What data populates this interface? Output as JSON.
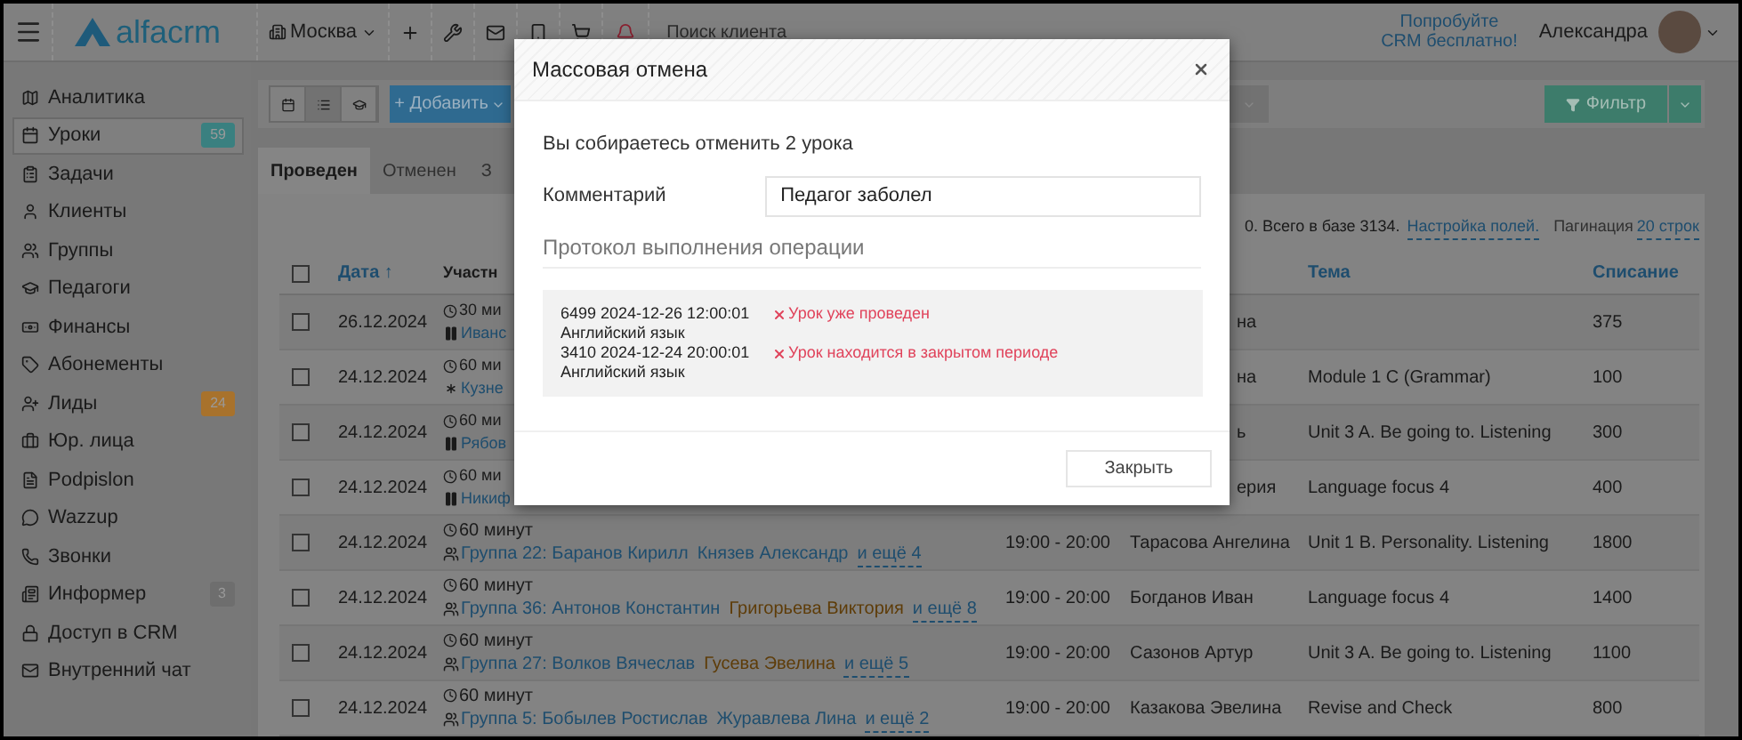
{
  "topbar": {
    "logo": "alfacrm",
    "city": "Москва",
    "search": {
      "placeholder": "Поиск клиента"
    },
    "promo": [
      "Попробуйте",
      "CRM бесплатно!"
    ],
    "user": "Александра"
  },
  "sidebar": {
    "items": [
      {
        "label": "Аналитика",
        "selected": false
      },
      {
        "label": "Уроки",
        "selected": true,
        "badge": "59",
        "color": "#3a8080"
      },
      {
        "label": "Задачи",
        "selected": false
      },
      {
        "label": "Клиенты",
        "selected": false
      },
      {
        "label": "Группы",
        "selected": false
      },
      {
        "label": "Педагоги",
        "selected": false
      },
      {
        "label": "Финансы",
        "selected": false
      },
      {
        "label": "Абонементы",
        "selected": false
      },
      {
        "label": "Лиды",
        "selected": false,
        "badge": "24",
        "color": "#a8722c"
      },
      {
        "label": "Юр. лица",
        "selected": false
      },
      {
        "label": "Podpislon",
        "selected": false
      },
      {
        "label": "Wazzup",
        "selected": false
      },
      {
        "label": "Звонки",
        "selected": false
      },
      {
        "label": "Информер",
        "selected": false,
        "badge": "3",
        "color": "#6e6e6e"
      },
      {
        "label": "Доступ в CRM",
        "selected": false
      },
      {
        "label": "Внутренний чат",
        "selected": false
      }
    ]
  },
  "toolbar": {
    "views": [
      {
        "selected": false
      },
      {
        "selected": true
      },
      {
        "selected": false
      }
    ],
    "add_button": "+ Добавить",
    "filter_button": "Фильтр"
  },
  "tabs": [
    {
      "label": "Проведен",
      "selected": true
    },
    {
      "label": "Отменен",
      "selected": false
    },
    {
      "label": "З",
      "selected": false
    }
  ],
  "table": {
    "all_checked": false,
    "info": "0. Всего в базе 3134.",
    "settings_link": "Настройка полей.",
    "pagination_label": "Пагинация",
    "pagination_link": "20 строк",
    "columns": [
      "Дата ↑",
      "Участн",
      "Тема",
      "Списание"
    ],
    "rows": [
      {
        "checked": false,
        "date": "26.12.2024",
        "duration": "30 ми",
        "kind": "individual",
        "participant": "Иванс",
        "teacher": "на",
        "theme": "",
        "amount": "375"
      },
      {
        "checked": false,
        "date": "24.12.2024",
        "duration": "60 ми",
        "kind": "trial",
        "participant": "Кузне",
        "teacher": "на",
        "theme": "Module 1 C (Grammar)",
        "amount": "100"
      },
      {
        "checked": false,
        "date": "24.12.2024",
        "duration": "60 ми",
        "kind": "individual",
        "participant": "Рябов",
        "teacher": "ь",
        "theme": "Unit 3 A. Be going to. Listening",
        "amount": "300"
      },
      {
        "checked": false,
        "date": "24.12.2024",
        "duration": "60 ми",
        "kind": "individual",
        "participant": "Никиф",
        "teacher": "ерия",
        "theme": "Language focus 4",
        "amount": "400"
      },
      {
        "checked": false,
        "date": "24.12.2024",
        "duration": "60 минут",
        "kind": "group",
        "participant": "Группа 22: Баранов Кирилл",
        "members": [
          {
            "name": "Князев Александр",
            "color": "#1f4e6e"
          }
        ],
        "more": "и ещё 4",
        "time": "19:00 - 20:00",
        "teacher": "Тарасова Ангелина",
        "theme": "Unit 1 B. Personality. Listening",
        "amount": "1800"
      },
      {
        "checked": false,
        "date": "24.12.2024",
        "duration": "60 минут",
        "kind": "group",
        "participant": "Группа 36: Антонов Константин",
        "members": [
          {
            "name": "Григорьева Виктория",
            "color": "#5e3c08"
          }
        ],
        "more": "и ещё 8",
        "time": "19:00 - 20:00",
        "teacher": "Богданов Иван",
        "theme": "Language focus 4",
        "amount": "1400"
      },
      {
        "checked": false,
        "date": "24.12.2024",
        "duration": "60 минут",
        "kind": "group",
        "participant": "Группа 27: Волков Вячеслав",
        "members": [
          {
            "name": "Гусева Эвелина",
            "color": "#5e3c08"
          }
        ],
        "more": "и ещё 5",
        "time": "19:00 - 20:00",
        "teacher": "Сазонов Артур",
        "theme": "Unit 3 A. Be going to. Listening",
        "amount": "1100"
      },
      {
        "checked": false,
        "date": "24.12.2024",
        "duration": "60 минут",
        "kind": "group",
        "participant": "Группа 5: Бобылев Ростислав",
        "members": [
          {
            "name": "Журавлева Лина",
            "color": "#1f4e6e"
          }
        ],
        "more": "и ещё 2",
        "time": "19:00 - 20:00",
        "teacher": "Казакова Эвелина",
        "theme": "Revise and Check",
        "amount": "800"
      }
    ]
  },
  "modal": {
    "title": "Массовая отмена",
    "message": "Вы собираетесь отменить 2 урока",
    "comment_label": "Комментарий",
    "comment_value": "Педагог заболел",
    "log_title": "Протокол выполнения операции",
    "log": [
      {
        "lesson": "6499 2024-12-26 12:00:01",
        "subject": "Английский язык",
        "error": "Урок уже проведен"
      },
      {
        "lesson": "3410 2024-12-24 20:00:01",
        "subject": "Английский язык",
        "error": "Урок находится в закрытом периоде"
      }
    ],
    "close_button": "Закрыть"
  }
}
